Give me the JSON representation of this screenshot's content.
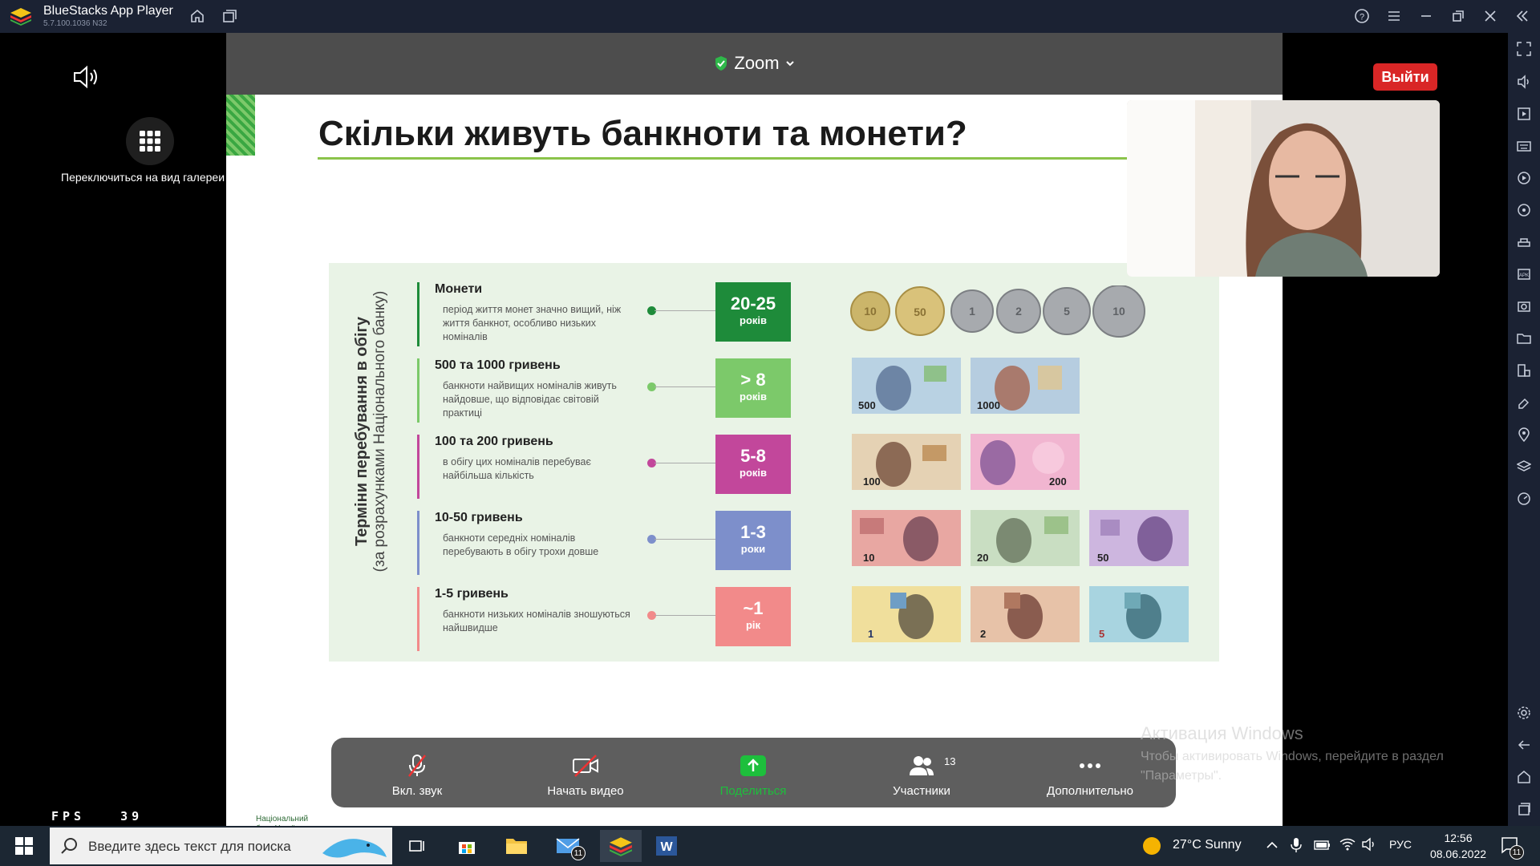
{
  "window": {
    "title": "BlueStacks App Player",
    "version": "5.7.100.1036  N32"
  },
  "zoom": {
    "title": "Zoom",
    "gallery_label": "Переключиться на вид галереи",
    "exit_label": "Выйти",
    "fps_label": "FPS",
    "fps_value": "39",
    "toolbar": {
      "mute": "Вкл. звук",
      "video": "Начать видео",
      "share": "Поделиться",
      "participants": "Участники",
      "participants_count": "13",
      "more": "Дополнительно"
    }
  },
  "slide": {
    "title": "Скільки живуть банкноти та монети?",
    "vertical_title": "Терміни перебування в обігу",
    "vertical_subtitle": "(за розрахунками Національного банку)",
    "rows": [
      {
        "title": "Монети",
        "desc": "період життя монет значно вищий, ніж життя банкнот, особливо низьких номіналів",
        "badge": "20-25",
        "unit": "років",
        "color": "#1e8b3a"
      },
      {
        "title": "500 та 1000 гривень",
        "desc": "банкноти найвищих номіналів живуть найдовше, що відповідає світовій практиці",
        "badge": "> 8",
        "unit": "років",
        "color": "#7cc96a"
      },
      {
        "title": "100 та 200 гривень",
        "desc": "в обігу цих номіналів перебуває найбільша кількість",
        "badge": "5-8",
        "unit": "років",
        "color": "#c2479b"
      },
      {
        "title": "10-50 гривень",
        "desc": "банкноти середніх номіналів перебувають в обігу трохи довше",
        "badge": "1-3",
        "unit": "роки",
        "color": "#7d8fcb"
      },
      {
        "title": "1-5 гривень",
        "desc": "банкноти низьких номіналів зношуються найшвидше",
        "badge": "~1",
        "unit": "рік",
        "color": "#f28a8a"
      }
    ],
    "coins": [
      "10",
      "50",
      "1",
      "2",
      "5",
      "10"
    ],
    "notes_row2": [
      "500",
      "1000"
    ],
    "notes_row3": [
      "100",
      "200"
    ],
    "notes_row4": [
      "10",
      "20",
      "50"
    ],
    "notes_row5": [
      "1",
      "2",
      "5"
    ],
    "bank_note": "Національний банк України"
  },
  "windows_activation": {
    "title": "Активация Windows",
    "text": "Чтобы активировать Windows, перейдите в раздел \"Параметры\"."
  },
  "taskbar": {
    "search_placeholder": "Введите здесь текст для поиска",
    "mail_badge": "11",
    "weather": "27°C  Sunny",
    "lang": "РУС",
    "time": "12:56",
    "date": "08.06.2022",
    "notif_badge": "11"
  }
}
